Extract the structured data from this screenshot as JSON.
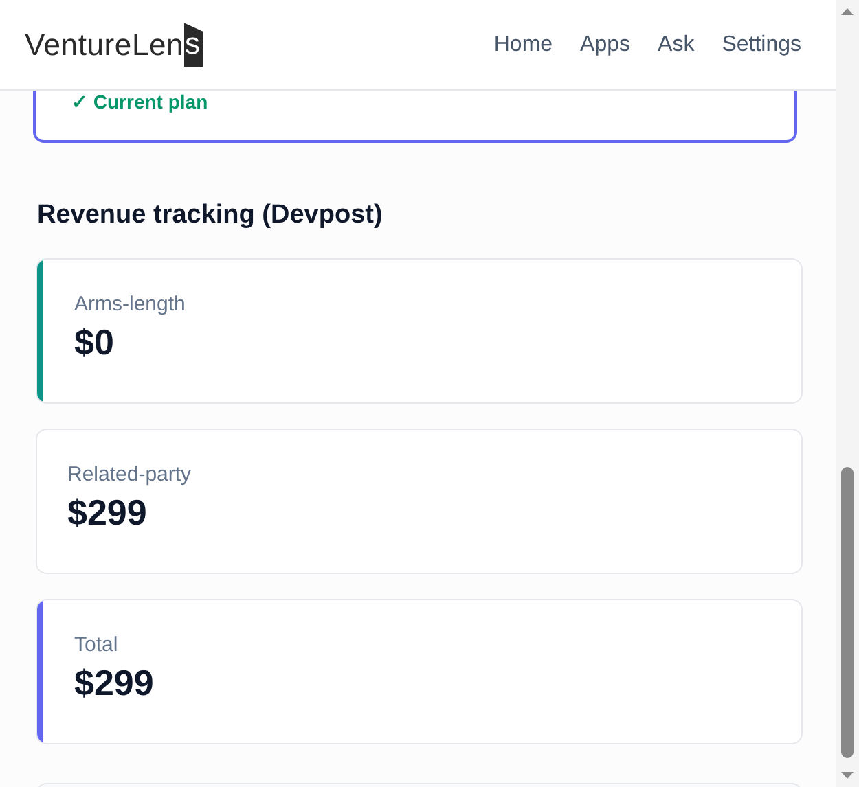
{
  "header": {
    "logo": "VentureLen",
    "logo_end": "s",
    "nav": [
      "Home",
      "Apps",
      "Ask",
      "Settings"
    ]
  },
  "plan_card": {
    "status": "✓ Current plan"
  },
  "section": {
    "title": "Revenue tracking (Devpost)",
    "cards": [
      {
        "label": "Arms-length",
        "value": "$0",
        "color": "#0d9488"
      },
      {
        "label": "Related-party",
        "value": "$299"
      },
      {
        "label": "Total",
        "value": "$299",
        "color": "#6366f1"
      }
    ]
  }
}
